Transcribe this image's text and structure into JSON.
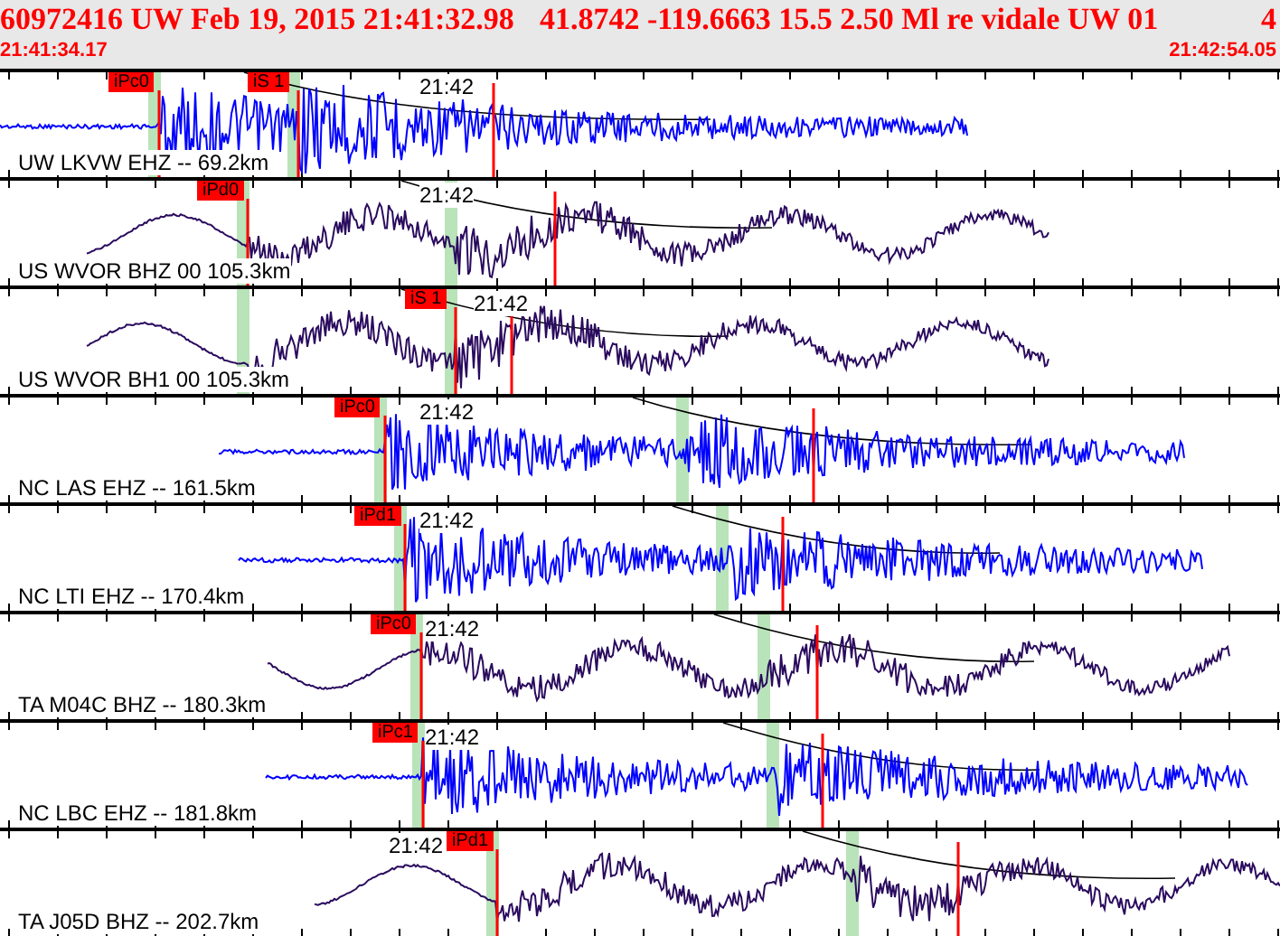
{
  "header": {
    "event": "60972416 UW Feb 19, 2015 21:41:32.98",
    "origin": "41.8742 -119.6663 15.5 2.50 Ml re vidale UW 01",
    "count": "4",
    "start_time": "21:41:34.17",
    "end_time": "21:42:54.05"
  },
  "traces": [
    {
      "label": "UW LKVW EHZ -- 69.2km",
      "color": "#0000ff",
      "kind": "short",
      "time_label": "21:42",
      "picks": [
        "iPc0",
        "iS 1"
      ]
    },
    {
      "label": "US WVOR BHZ 00 105.3km",
      "color": "#2a0a5e",
      "kind": "broad",
      "time_label": "21:42",
      "picks": [
        "iPd0"
      ]
    },
    {
      "label": "US WVOR BH1 00 105.3km",
      "color": "#2a0a5e",
      "kind": "broad",
      "time_label": "21:42",
      "picks": [
        "iS 1"
      ]
    },
    {
      "label": "NC LAS EHZ -- 161.5km",
      "color": "#0000ff",
      "kind": "short",
      "time_label": "21:42",
      "picks": [
        "iPc0"
      ]
    },
    {
      "label": "NC LTI EHZ -- 170.4km",
      "color": "#0000ff",
      "kind": "short",
      "time_label": "21:42",
      "picks": [
        "iPd1"
      ]
    },
    {
      "label": "TA M04C BHZ -- 180.3km",
      "color": "#2a0a5e",
      "kind": "broad",
      "time_label": "21:42",
      "picks": [
        "iPc0"
      ]
    },
    {
      "label": "NC LBC EHZ -- 181.8km",
      "color": "#0000ff",
      "kind": "short",
      "time_label": "21:42",
      "picks": [
        "iPc1"
      ]
    },
    {
      "label": "TA J05D BHZ -- 202.7km",
      "color": "#2a0a5e",
      "kind": "broad",
      "time_label": "21:42",
      "picks": [
        "iPd1"
      ]
    }
  ]
}
